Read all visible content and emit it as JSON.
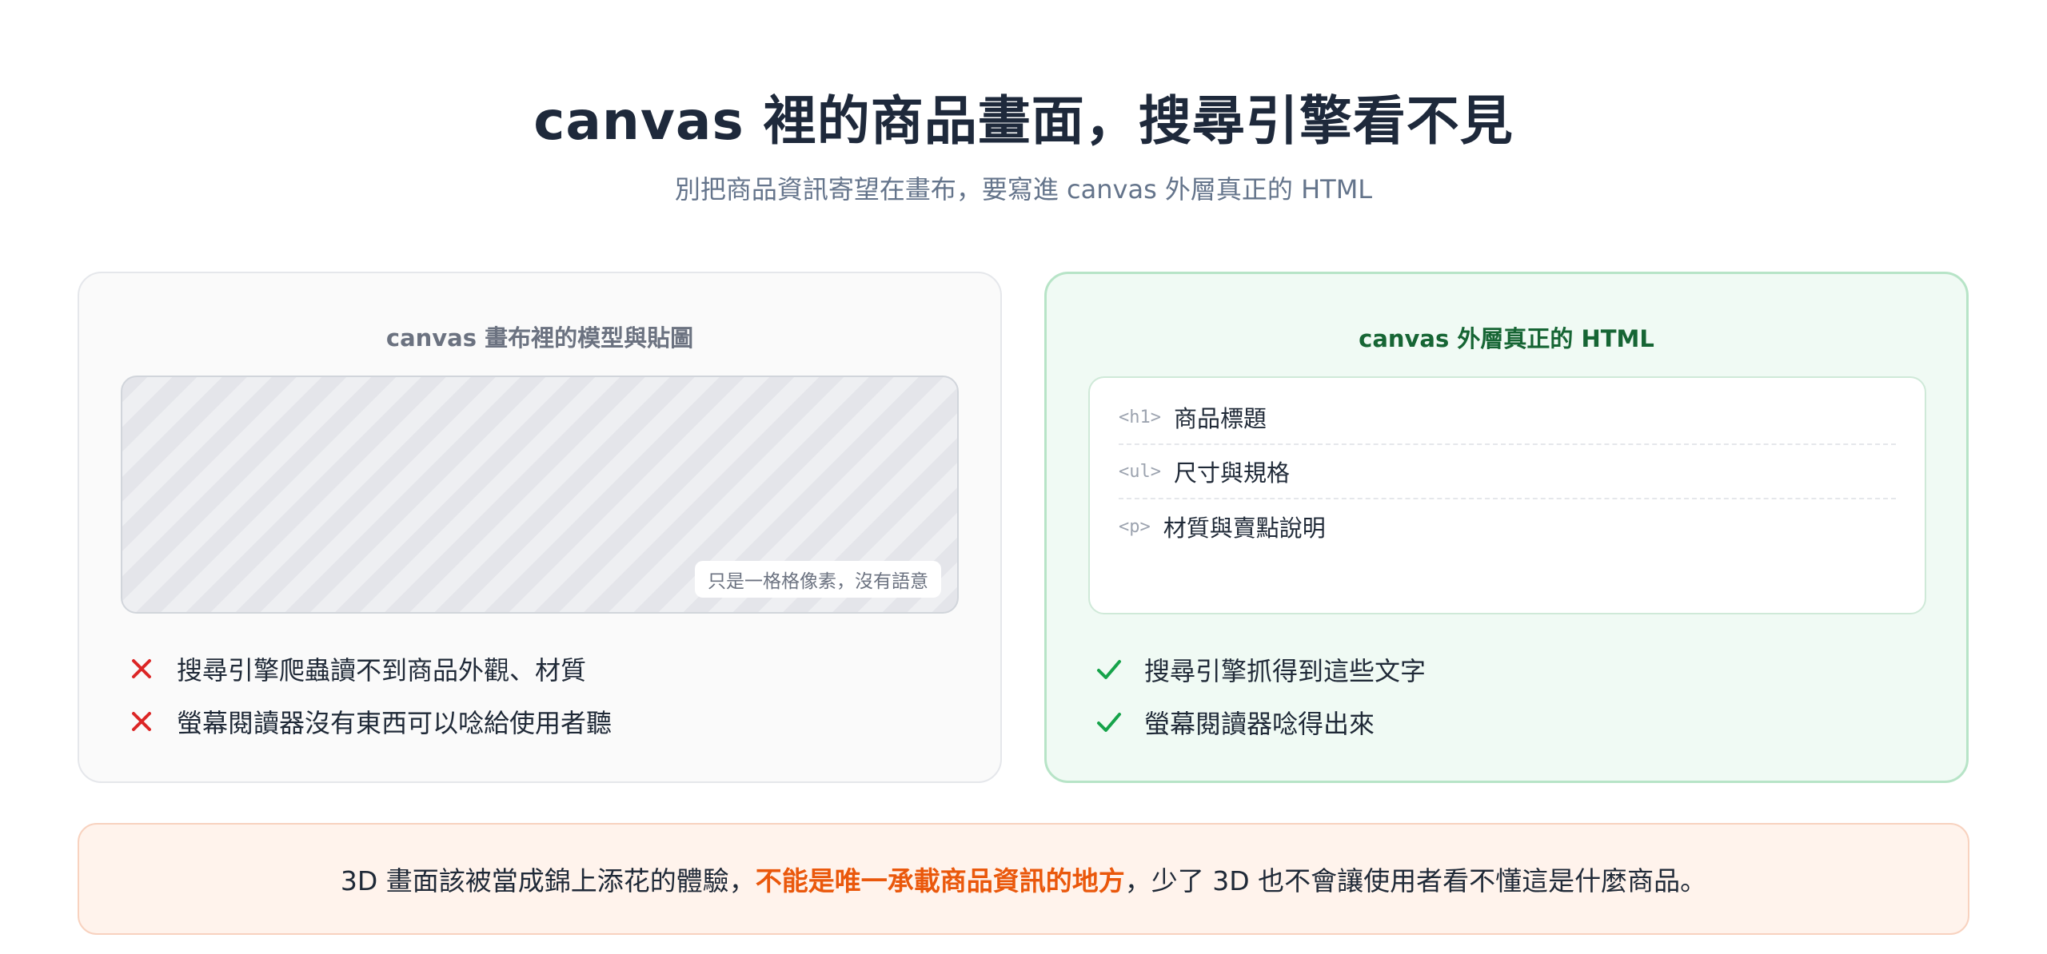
{
  "header": {
    "title": "canvas 裡的商品畫面，搜尋引擎看不見",
    "subtitle": "別把商品資訊寄望在畫布，要寫進 canvas 外層真正的 HTML"
  },
  "left_panel": {
    "title": "canvas 畫布裡的模型與貼圖",
    "canvas_note": "只是一格格像素，沒有語意",
    "bullets": [
      {
        "icon": "cross-icon",
        "text": "搜尋引擎爬蟲讀不到商品外觀、材質"
      },
      {
        "icon": "cross-icon",
        "text": "螢幕閱讀器沒有東西可以唸給使用者聽"
      }
    ]
  },
  "right_panel": {
    "title": "canvas 外層真正的 HTML",
    "rows": [
      {
        "tag": "<h1>",
        "text": "商品標題"
      },
      {
        "tag": "<ul>",
        "text": "尺寸與規格"
      },
      {
        "tag": "<p>",
        "text": "材質與賣點說明"
      }
    ],
    "bullets": [
      {
        "icon": "check-icon",
        "text": "搜尋引擎抓得到這些文字"
      },
      {
        "icon": "check-icon",
        "text": "螢幕閱讀器唸得出來"
      }
    ]
  },
  "bottom_note": {
    "before": "3D 畫面該被當成錦上添花的體驗，",
    "highlight": "不能是唯一承載商品資訊的地方",
    "after": "，少了 3D 也不會讓使用者看不懂這是什麼商品。"
  },
  "colors": {
    "title": "#1e293b",
    "accent_green": "#166534",
    "cross_red": "#dc2626",
    "check_green": "#16a34a",
    "highlight_orange": "#ea580c"
  }
}
